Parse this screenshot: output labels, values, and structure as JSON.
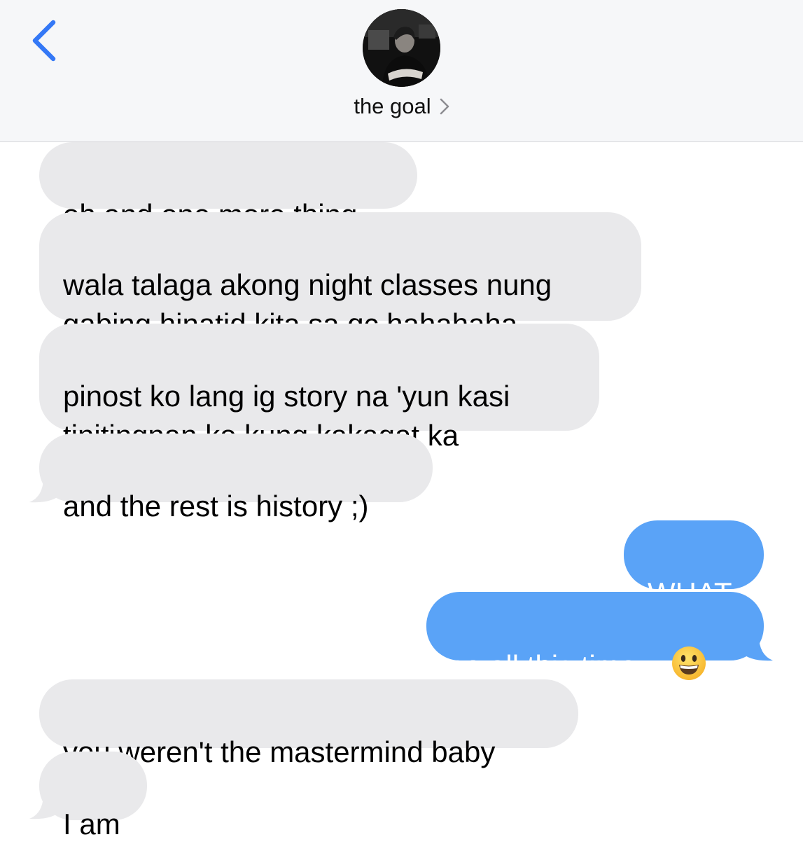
{
  "header": {
    "contact_name": "the goal",
    "back_icon": "chevron-left-icon",
    "accent_color": "#3478f6"
  },
  "messages": [
    {
      "side": "received",
      "text": "oh and one more thing"
    },
    {
      "side": "received",
      "text": "wala talaga akong night classes nung\ngabing hinatid kita sa qc hahahaha"
    },
    {
      "side": "received",
      "text": "pinost ko lang ig story na 'yun kasi\ntinitingnan ko kung kakagat ka"
    },
    {
      "side": "received",
      "text": "and the rest is history ;)"
    },
    {
      "side": "sent",
      "text": "WHAT"
    },
    {
      "side": "sent",
      "text": "so all this time...",
      "emoji": "grinning-face-emoji"
    },
    {
      "side": "received",
      "text": "you weren't the mastermind baby"
    },
    {
      "side": "received",
      "text": "I am"
    }
  ],
  "colors": {
    "received_bubble": "#e9e9eb",
    "sent_bubble": "#5aa3f7",
    "header_bg": "#f6f7f9"
  }
}
